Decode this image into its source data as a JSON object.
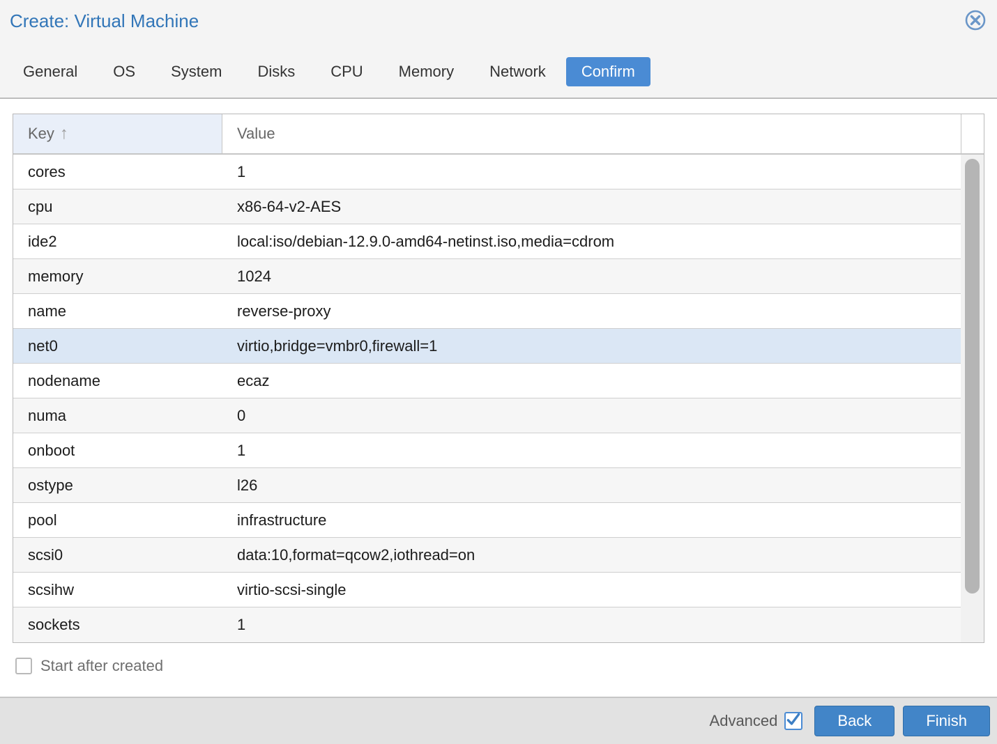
{
  "window": {
    "title": "Create: Virtual Machine"
  },
  "icons": {
    "close": "circle-x",
    "sort_ascending": "↑",
    "advanced_check": "checkmark"
  },
  "tabs": [
    {
      "label": "General",
      "active": false
    },
    {
      "label": "OS",
      "active": false
    },
    {
      "label": "System",
      "active": false
    },
    {
      "label": "Disks",
      "active": false
    },
    {
      "label": "CPU",
      "active": false
    },
    {
      "label": "Memory",
      "active": false
    },
    {
      "label": "Network",
      "active": false
    },
    {
      "label": "Confirm",
      "active": true
    }
  ],
  "table": {
    "columns": [
      {
        "label": "Key",
        "sorted": "ascending"
      },
      {
        "label": "Value",
        "sorted": null
      }
    ],
    "rows": [
      {
        "key": "cores",
        "value": "1"
      },
      {
        "key": "cpu",
        "value": "x86-64-v2-AES"
      },
      {
        "key": "ide2",
        "value": "local:iso/debian-12.9.0-amd64-netinst.iso,media=cdrom"
      },
      {
        "key": "memory",
        "value": "1024"
      },
      {
        "key": "name",
        "value": "reverse-proxy"
      },
      {
        "key": "net0",
        "value": "virtio,bridge=vmbr0,firewall=1"
      },
      {
        "key": "nodename",
        "value": "ecaz"
      },
      {
        "key": "numa",
        "value": "0"
      },
      {
        "key": "onboot",
        "value": "1"
      },
      {
        "key": "ostype",
        "value": "l26"
      },
      {
        "key": "pool",
        "value": "infrastructure"
      },
      {
        "key": "scsi0",
        "value": "data:10,format=qcow2,iothread=on"
      },
      {
        "key": "scsihw",
        "value": "virtio-scsi-single"
      },
      {
        "key": "sockets",
        "value": "1"
      }
    ],
    "selected_row_key": "net0"
  },
  "options": {
    "start_after_created": {
      "label": "Start after created",
      "checked": false
    }
  },
  "footer": {
    "advanced": {
      "label": "Advanced",
      "checked": true
    },
    "back_button": "Back",
    "finish_button": "Finish"
  },
  "colors": {
    "accent_blue": "#4a8bd4",
    "title_blue": "#3276b8",
    "button_blue": "#4285c8",
    "selected_row_bg": "#dbe7f5",
    "header_key_bg": "#e9eff9"
  }
}
